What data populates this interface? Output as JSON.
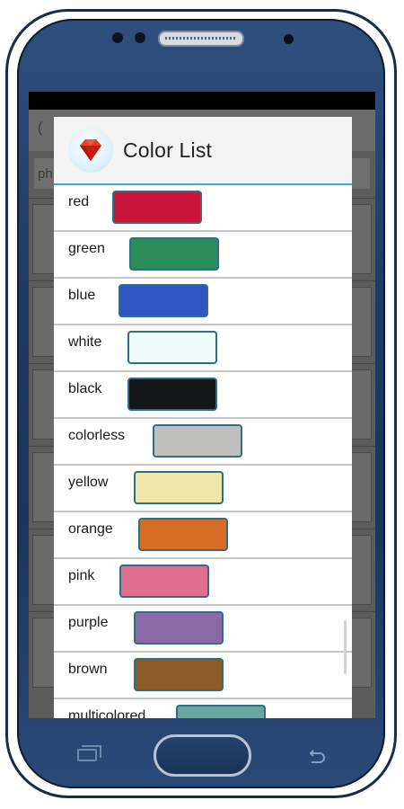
{
  "background_app": {
    "header_text": "(",
    "field_text": "ph"
  },
  "dialog": {
    "title": "Color List",
    "icon": "ruby-gem-icon"
  },
  "colors": [
    {
      "label": "red",
      "color": "#c8143a",
      "border": "#2d6f86"
    },
    {
      "label": "green",
      "color": "#2e8c5a",
      "border": "#2d6f86"
    },
    {
      "label": "blue",
      "color": "#2e57c4",
      "border": "#2d6f86"
    },
    {
      "label": "white",
      "color": "#f0fcfb",
      "border": "#2d6f86"
    },
    {
      "label": "black",
      "color": "#14161c",
      "border": "#2d6f86"
    },
    {
      "label": "colorless",
      "color": "#bfbfbd",
      "border": "#2d6f86"
    },
    {
      "label": "yellow",
      "color": "#f0e6a8",
      "border": "#2d6f86"
    },
    {
      "label": "orange",
      "color": "#d66c26",
      "border": "#2d6f86"
    },
    {
      "label": "pink",
      "color": "#e0708f",
      "border": "#2d6f86"
    },
    {
      "label": "purple",
      "color": "#8b69a7",
      "border": "#2d6f86"
    },
    {
      "label": "brown",
      "color": "#8a5b24",
      "border": "#2d6f86"
    },
    {
      "label": "multicolored",
      "color": "#6aa7a0",
      "border": "#2d6f86"
    }
  ],
  "hardware": {
    "recent_icon": "recent-apps-icon",
    "home_icon": "home-button",
    "back_icon": "back-icon"
  }
}
